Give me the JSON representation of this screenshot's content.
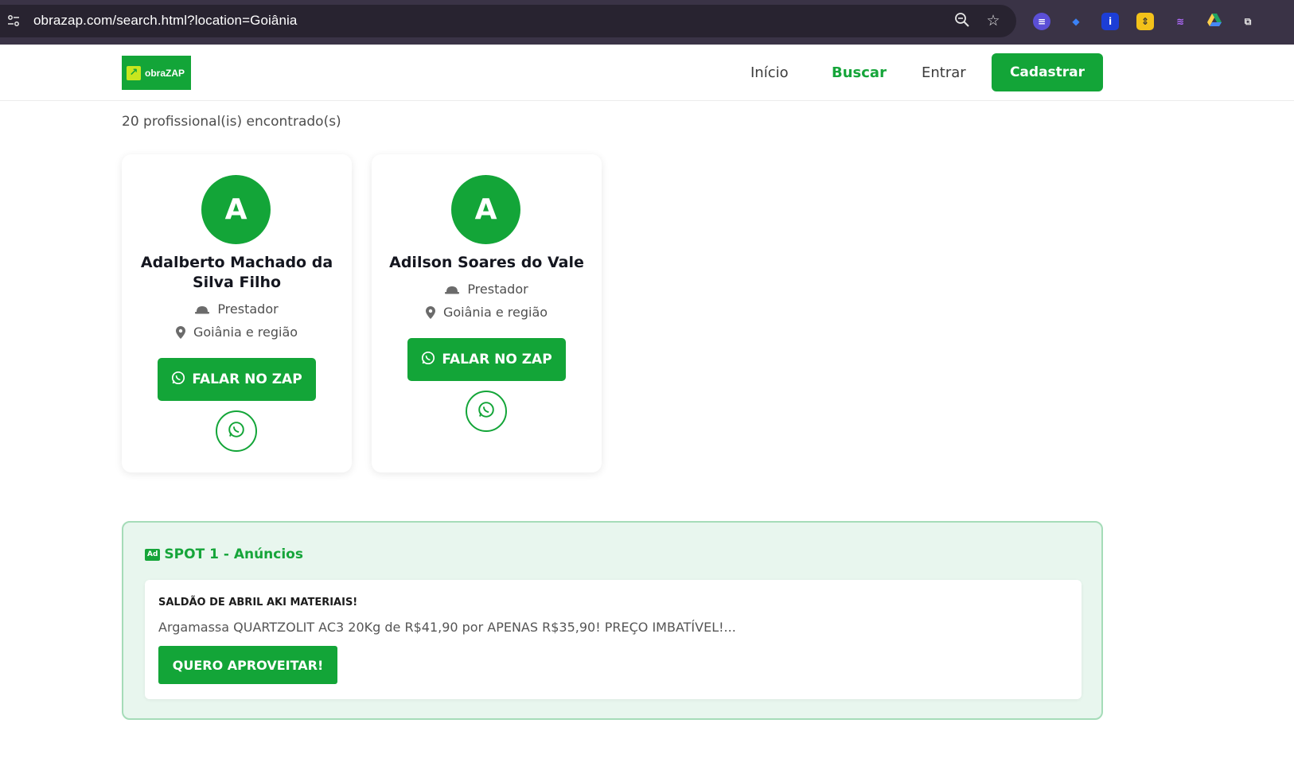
{
  "browser": {
    "url": "obrazap.com/search.html?location=Goiânia",
    "extensions": [
      "translate-extension-icon",
      "tag-extension-icon",
      "info-extension-icon",
      "sort-extension-icon",
      "wave-extension-icon",
      "google-drive-icon"
    ]
  },
  "header": {
    "logo_text": "obraZAP",
    "nav": {
      "inicio": "Início",
      "buscar": "Buscar",
      "entrar": "Entrar"
    },
    "cta": "Cadastrar"
  },
  "results": {
    "count_text": "20 profissional(is) encontrado(s)"
  },
  "cards": [
    {
      "initial": "A",
      "name": "Adalberto Machado da Silva Filho",
      "role": "Prestador",
      "location": "Goiânia e região",
      "button": "FALAR NO ZAP"
    },
    {
      "initial": "A",
      "name": "Adilson Soares do Vale",
      "role": "Prestador",
      "location": "Goiânia e região",
      "button": "FALAR NO ZAP"
    }
  ],
  "spot": {
    "badge": "Ad",
    "title": "SPOT 1 - Anúncios",
    "ad": {
      "heading": "SALDÃO DE ABRIL AKI MATERIAIS!",
      "text": "Argamassa QUARTZOLIT AC3 20Kg de R$41,90 por APENAS R$35,90! PREÇO IMBATÍVEL!...",
      "button": "QUERO APROVEITAR!"
    }
  },
  "colors": {
    "brand_green": "#13a538",
    "spot_bg": "#e8f6ee"
  }
}
